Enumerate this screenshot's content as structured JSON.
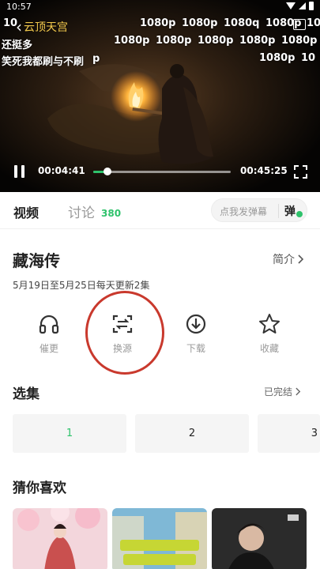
{
  "status_bar": {
    "time": "10:57"
  },
  "player": {
    "show_title": "云顶天宫",
    "danmaku": [
      "10",
      "1080p",
      "1080p",
      "1080q",
      "1080p",
      "10",
      "1080p",
      "1080p",
      "1080p",
      "1080p",
      "1080p",
      "1080p",
      "1080p",
      "10",
      "还挺多",
      "笑死我都刷与不刷",
      "p"
    ],
    "current_time": "00:04:41",
    "total_time": "00:45:25",
    "progress": 0.103,
    "colors": {
      "accent": "#2ec26b",
      "title": "#f2c94c"
    }
  },
  "tabs": {
    "video_label": "视频",
    "discuss_label": "讨论",
    "discuss_count": "380",
    "danmaku_placeholder": "点我发弹幕",
    "danmaku_button": "弹"
  },
  "info": {
    "title": "藏海传",
    "intro_label": "简介",
    "schedule": "5月19日至5月25日每天更新2集"
  },
  "actions": [
    {
      "label": "催更",
      "icon": "headphones-icon"
    },
    {
      "label": "换源",
      "icon": "switch-source-icon"
    },
    {
      "label": "下载",
      "icon": "download-icon"
    },
    {
      "label": "收藏",
      "icon": "star-icon"
    }
  ],
  "episodes": {
    "title": "选集",
    "status": "已完结",
    "items": [
      "1",
      "2",
      "3"
    ],
    "active": "1"
  },
  "recommend": {
    "title": "猜你喜欢"
  }
}
